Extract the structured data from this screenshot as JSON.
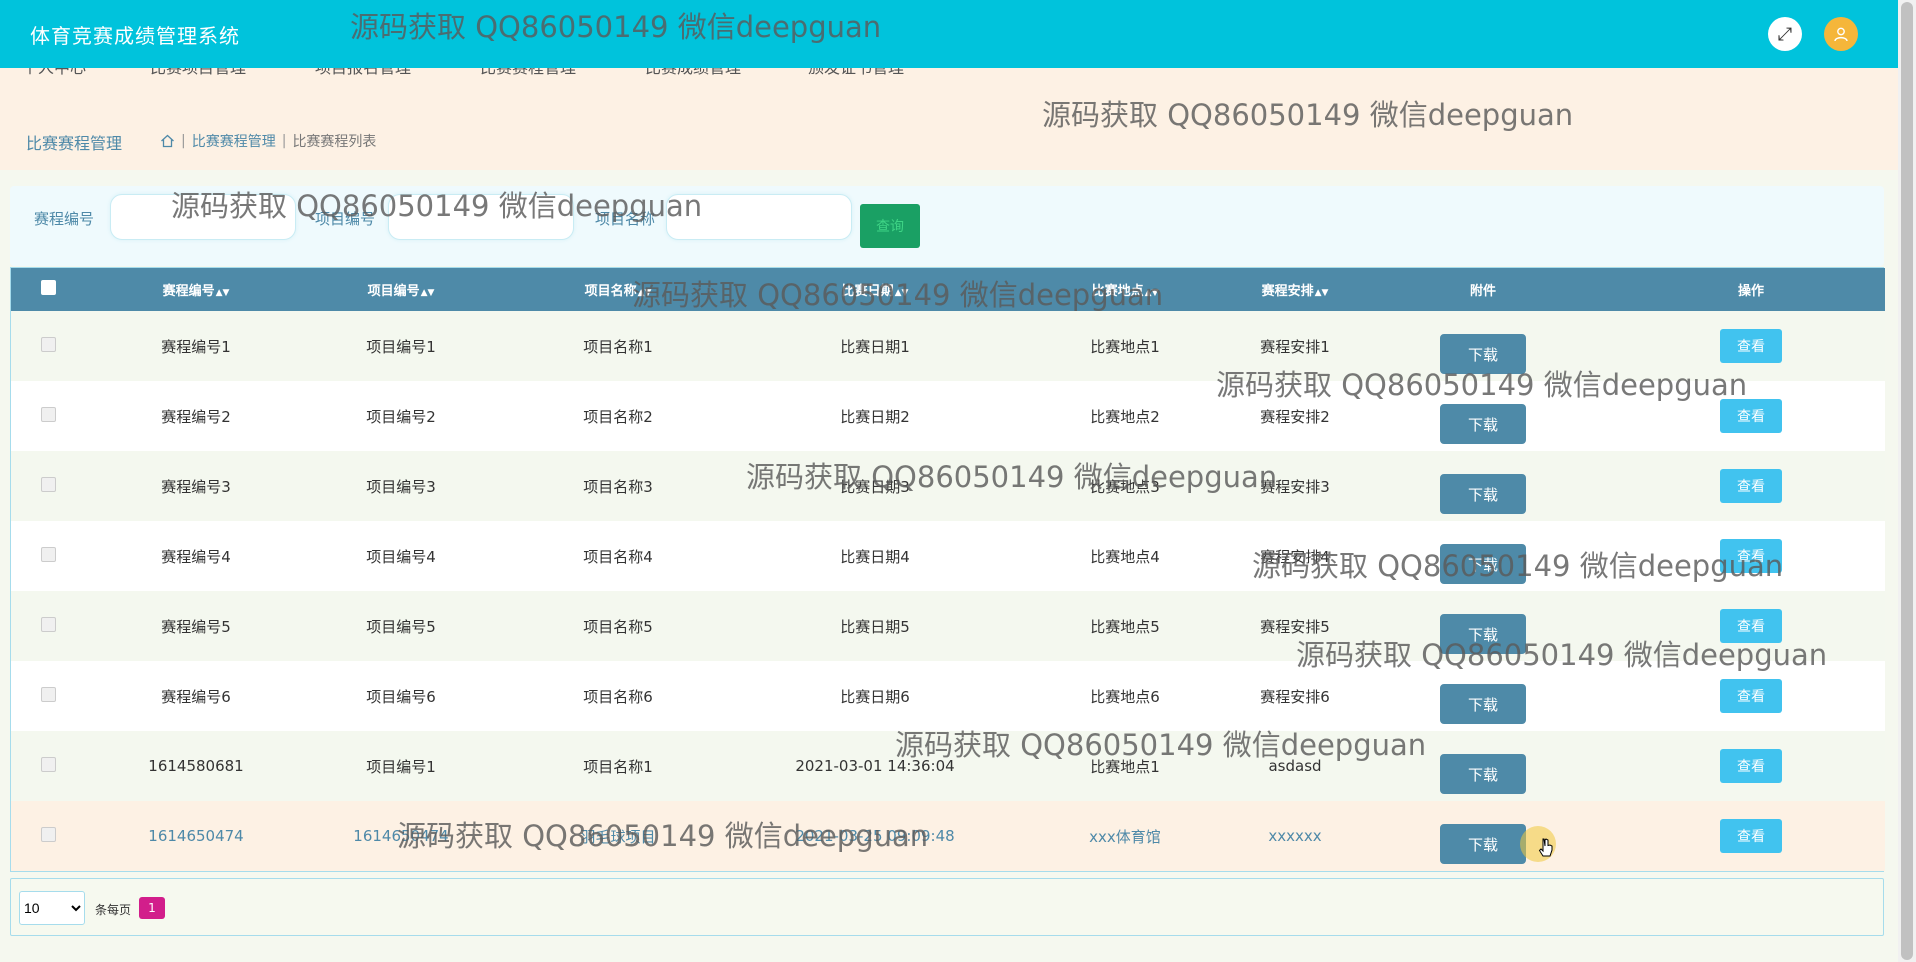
{
  "app": {
    "title": "体育竞赛成绩管理系统"
  },
  "nav": {
    "items": [
      "个人中心",
      "比赛项目管理",
      "项目报名管理",
      "比赛赛程管理",
      "比赛成绩管理",
      "颁发证书管理"
    ]
  },
  "page": {
    "section_title": "比赛赛程管理",
    "breadcrumb": [
      "比赛赛程管理",
      "比赛赛程列表"
    ]
  },
  "search": {
    "fields": [
      {
        "label": "赛程编号",
        "value": ""
      },
      {
        "label": "项目编号",
        "value": ""
      },
      {
        "label": "项目名称",
        "value": ""
      }
    ],
    "button_label": "查询"
  },
  "table": {
    "headers": [
      "赛程编号",
      "项目编号",
      "项目名称",
      "比赛日期",
      "比赛地点",
      "赛程安排",
      "附件",
      "操作"
    ],
    "rows": [
      [
        "赛程编号1",
        "项目编号1",
        "项目名称1",
        "比赛日期1",
        "比赛地点1",
        "赛程安排1"
      ],
      [
        "赛程编号2",
        "项目编号2",
        "项目名称2",
        "比赛日期2",
        "比赛地点2",
        "赛程安排2"
      ],
      [
        "赛程编号3",
        "项目编号3",
        "项目名称3",
        "比赛日期3",
        "比赛地点3",
        "赛程安排3"
      ],
      [
        "赛程编号4",
        "项目编号4",
        "项目名称4",
        "比赛日期4",
        "比赛地点4",
        "赛程安排4"
      ],
      [
        "赛程编号5",
        "项目编号5",
        "项目名称5",
        "比赛日期5",
        "比赛地点5",
        "赛程安排5"
      ],
      [
        "赛程编号6",
        "项目编号6",
        "项目名称6",
        "比赛日期6",
        "比赛地点6",
        "赛程安排6"
      ],
      [
        "1614580681",
        "项目编号1",
        "项目名称1",
        "2021-03-01 14:36:04",
        "比赛地点1",
        "asdasd"
      ],
      [
        "1614650474",
        "1614650474",
        "羽毛球项目",
        "2021-03-25 09:09:48",
        "xxx体育馆",
        "xxxxxx"
      ]
    ],
    "download_label": "下载",
    "view_label": "查看"
  },
  "pager": {
    "page_size": "10",
    "per_page_label": "条每页",
    "current_page": "1"
  },
  "watermark": "源码获取 QQ86050149 微信deepguan",
  "colors": {
    "topbar": "#00c3dc",
    "table_header": "#4e8aa8",
    "view_button": "#41c3ef",
    "search_button": "#1aa064",
    "page_active": "#d21e8b"
  }
}
